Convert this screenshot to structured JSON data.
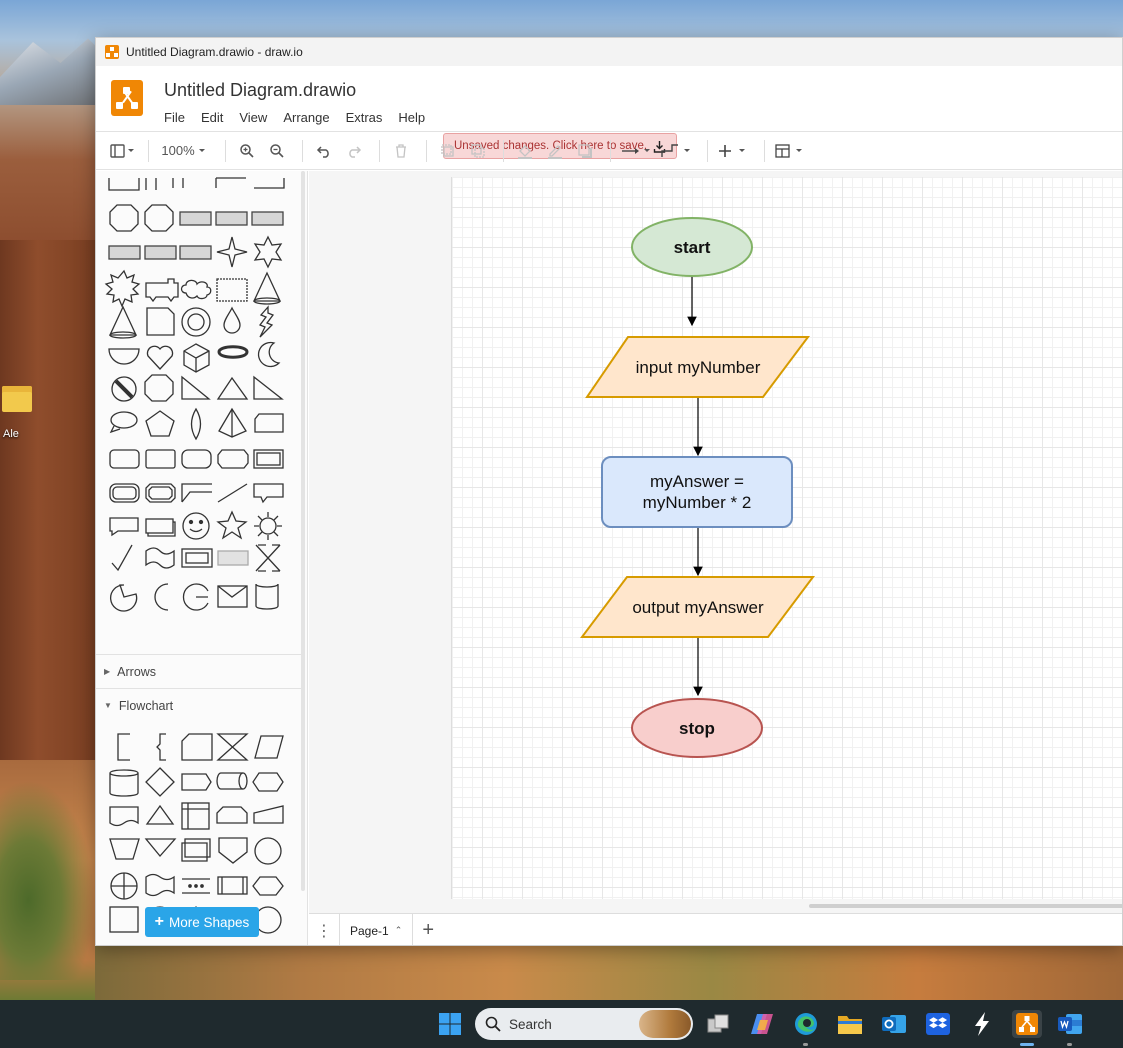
{
  "window": {
    "title": "Untitled Diagram.drawio - draw.io"
  },
  "header": {
    "doc_title": "Untitled Diagram.drawio",
    "menu": [
      "File",
      "Edit",
      "View",
      "Arrange",
      "Extras",
      "Help"
    ],
    "unsaved_label": "Unsaved changes. Click here to save."
  },
  "toolbar": {
    "zoom": "100%"
  },
  "sidebar": {
    "sections": [
      {
        "label": "Arrows",
        "expanded": false
      },
      {
        "label": "Flowchart",
        "expanded": true
      }
    ],
    "more_shapes": "More Shapes"
  },
  "diagram": {
    "nodes": [
      {
        "id": "start",
        "label": "start",
        "shape": "ellipse",
        "fill": "#d5e8d4",
        "stroke": "#82b366"
      },
      {
        "id": "input",
        "label": "input myNumber",
        "shape": "parallelogram",
        "fill": "#ffe6cc",
        "stroke": "#d79b00"
      },
      {
        "id": "process",
        "label": "myAnswer =\nmyNumber * 2",
        "shape": "rounded-rect",
        "fill": "#dae8fc",
        "stroke": "#6c8ebf"
      },
      {
        "id": "output",
        "label": "output myAnswer",
        "shape": "parallelogram",
        "fill": "#ffe6cc",
        "stroke": "#d79b00"
      },
      {
        "id": "stop",
        "label": "stop",
        "shape": "ellipse",
        "fill": "#f8cecc",
        "stroke": "#b85450"
      }
    ],
    "edges": [
      {
        "from": "start",
        "to": "input"
      },
      {
        "from": "input",
        "to": "process"
      },
      {
        "from": "process",
        "to": "output"
      },
      {
        "from": "output",
        "to": "stop"
      }
    ]
  },
  "pages": {
    "tabs": [
      "Page-1"
    ]
  },
  "desktop": {
    "icon_label": "Ale"
  },
  "taskbar": {
    "search_placeholder": "Search",
    "apps": [
      "windows-start",
      "search",
      "task-view",
      "copilot",
      "edge",
      "file-explorer",
      "outlook",
      "dropbox",
      "cursor",
      "drawio",
      "word"
    ]
  }
}
